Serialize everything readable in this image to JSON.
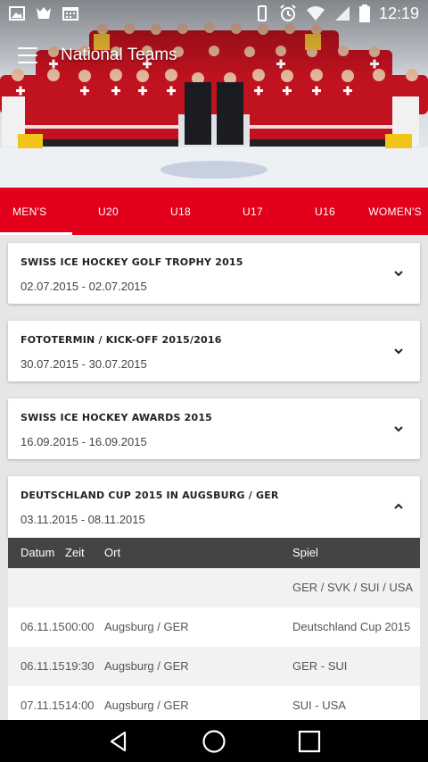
{
  "status_bar": {
    "time": "12:19",
    "left_icons": [
      "image-icon",
      "notification-icon",
      "calendar-icon"
    ],
    "right_icons": [
      "vibrate-icon",
      "alarm-icon",
      "wifi-icon",
      "signal-icon",
      "battery-icon"
    ]
  },
  "toolbar": {
    "title": "National Teams"
  },
  "tabs": [
    {
      "label": "MEN'S",
      "selected": true
    },
    {
      "label": "U20",
      "selected": false
    },
    {
      "label": "U18",
      "selected": false
    },
    {
      "label": "U17",
      "selected": false
    },
    {
      "label": "U16",
      "selected": false
    },
    {
      "label": "WOMEN'S",
      "selected": false
    }
  ],
  "events": [
    {
      "title": "Swiss Ice Hockey Golf Trophy 2015",
      "dates": "02.07.2015 - 02.07.2015",
      "expanded": false
    },
    {
      "title": "Fototermin / Kick-Off 2015/2016",
      "dates": "30.07.2015 - 30.07.2015",
      "expanded": false
    },
    {
      "title": "Swiss Ice Hockey Awards 2015",
      "dates": "16.09.2015 - 16.09.2015",
      "expanded": false
    },
    {
      "title": "Deutschland Cup 2015 in Augsburg / GER",
      "dates": "03.11.2015 - 08.11.2015",
      "expanded": true
    }
  ],
  "schedule": {
    "headers": {
      "datum": "Datum",
      "zeit": "Zeit",
      "ort": "Ort",
      "spiel": "Spiel"
    },
    "rows": [
      {
        "datum": "",
        "zeit": "",
        "ort": "",
        "spiel": "GER / SVK / SUI / USA"
      },
      {
        "datum": "06.11.15",
        "zeit": "00:00",
        "ort": "Augsburg / GER",
        "spiel": "Deutschland Cup 2015"
      },
      {
        "datum": "06.11.15",
        "zeit": "19:30",
        "ort": "Augsburg / GER",
        "spiel": "GER - SUI"
      },
      {
        "datum": "07.11.15",
        "zeit": "14:00",
        "ort": "Augsburg / GER",
        "spiel": "SUI - USA"
      }
    ]
  },
  "nav_bar": {
    "icons": [
      "back-icon",
      "home-icon",
      "recents-icon"
    ]
  },
  "colors": {
    "accent": "#e2001a",
    "table_header": "#444444"
  }
}
